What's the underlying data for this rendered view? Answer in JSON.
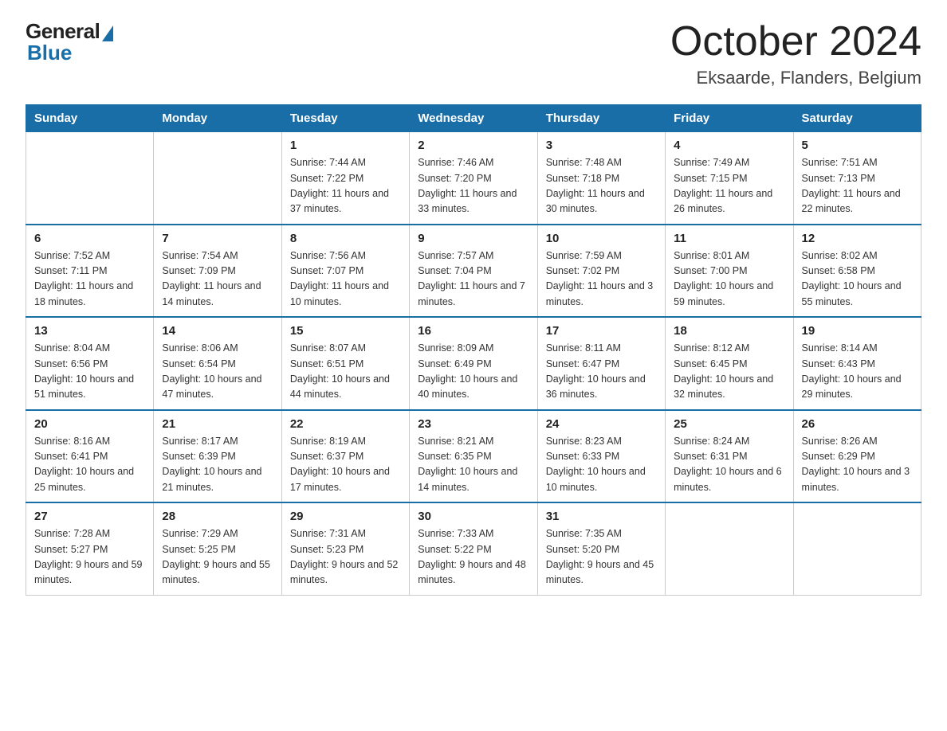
{
  "header": {
    "logo_general": "General",
    "logo_blue": "Blue",
    "month_title": "October 2024",
    "location": "Eksaarde, Flanders, Belgium"
  },
  "weekdays": [
    "Sunday",
    "Monday",
    "Tuesday",
    "Wednesday",
    "Thursday",
    "Friday",
    "Saturday"
  ],
  "weeks": [
    [
      {
        "day": "",
        "info": ""
      },
      {
        "day": "",
        "info": ""
      },
      {
        "day": "1",
        "info": "Sunrise: 7:44 AM\nSunset: 7:22 PM\nDaylight: 11 hours\nand 37 minutes."
      },
      {
        "day": "2",
        "info": "Sunrise: 7:46 AM\nSunset: 7:20 PM\nDaylight: 11 hours\nand 33 minutes."
      },
      {
        "day": "3",
        "info": "Sunrise: 7:48 AM\nSunset: 7:18 PM\nDaylight: 11 hours\nand 30 minutes."
      },
      {
        "day": "4",
        "info": "Sunrise: 7:49 AM\nSunset: 7:15 PM\nDaylight: 11 hours\nand 26 minutes."
      },
      {
        "day": "5",
        "info": "Sunrise: 7:51 AM\nSunset: 7:13 PM\nDaylight: 11 hours\nand 22 minutes."
      }
    ],
    [
      {
        "day": "6",
        "info": "Sunrise: 7:52 AM\nSunset: 7:11 PM\nDaylight: 11 hours\nand 18 minutes."
      },
      {
        "day": "7",
        "info": "Sunrise: 7:54 AM\nSunset: 7:09 PM\nDaylight: 11 hours\nand 14 minutes."
      },
      {
        "day": "8",
        "info": "Sunrise: 7:56 AM\nSunset: 7:07 PM\nDaylight: 11 hours\nand 10 minutes."
      },
      {
        "day": "9",
        "info": "Sunrise: 7:57 AM\nSunset: 7:04 PM\nDaylight: 11 hours\nand 7 minutes."
      },
      {
        "day": "10",
        "info": "Sunrise: 7:59 AM\nSunset: 7:02 PM\nDaylight: 11 hours\nand 3 minutes."
      },
      {
        "day": "11",
        "info": "Sunrise: 8:01 AM\nSunset: 7:00 PM\nDaylight: 10 hours\nand 59 minutes."
      },
      {
        "day": "12",
        "info": "Sunrise: 8:02 AM\nSunset: 6:58 PM\nDaylight: 10 hours\nand 55 minutes."
      }
    ],
    [
      {
        "day": "13",
        "info": "Sunrise: 8:04 AM\nSunset: 6:56 PM\nDaylight: 10 hours\nand 51 minutes."
      },
      {
        "day": "14",
        "info": "Sunrise: 8:06 AM\nSunset: 6:54 PM\nDaylight: 10 hours\nand 47 minutes."
      },
      {
        "day": "15",
        "info": "Sunrise: 8:07 AM\nSunset: 6:51 PM\nDaylight: 10 hours\nand 44 minutes."
      },
      {
        "day": "16",
        "info": "Sunrise: 8:09 AM\nSunset: 6:49 PM\nDaylight: 10 hours\nand 40 minutes."
      },
      {
        "day": "17",
        "info": "Sunrise: 8:11 AM\nSunset: 6:47 PM\nDaylight: 10 hours\nand 36 minutes."
      },
      {
        "day": "18",
        "info": "Sunrise: 8:12 AM\nSunset: 6:45 PM\nDaylight: 10 hours\nand 32 minutes."
      },
      {
        "day": "19",
        "info": "Sunrise: 8:14 AM\nSunset: 6:43 PM\nDaylight: 10 hours\nand 29 minutes."
      }
    ],
    [
      {
        "day": "20",
        "info": "Sunrise: 8:16 AM\nSunset: 6:41 PM\nDaylight: 10 hours\nand 25 minutes."
      },
      {
        "day": "21",
        "info": "Sunrise: 8:17 AM\nSunset: 6:39 PM\nDaylight: 10 hours\nand 21 minutes."
      },
      {
        "day": "22",
        "info": "Sunrise: 8:19 AM\nSunset: 6:37 PM\nDaylight: 10 hours\nand 17 minutes."
      },
      {
        "day": "23",
        "info": "Sunrise: 8:21 AM\nSunset: 6:35 PM\nDaylight: 10 hours\nand 14 minutes."
      },
      {
        "day": "24",
        "info": "Sunrise: 8:23 AM\nSunset: 6:33 PM\nDaylight: 10 hours\nand 10 minutes."
      },
      {
        "day": "25",
        "info": "Sunrise: 8:24 AM\nSunset: 6:31 PM\nDaylight: 10 hours\nand 6 minutes."
      },
      {
        "day": "26",
        "info": "Sunrise: 8:26 AM\nSunset: 6:29 PM\nDaylight: 10 hours\nand 3 minutes."
      }
    ],
    [
      {
        "day": "27",
        "info": "Sunrise: 7:28 AM\nSunset: 5:27 PM\nDaylight: 9 hours\nand 59 minutes."
      },
      {
        "day": "28",
        "info": "Sunrise: 7:29 AM\nSunset: 5:25 PM\nDaylight: 9 hours\nand 55 minutes."
      },
      {
        "day": "29",
        "info": "Sunrise: 7:31 AM\nSunset: 5:23 PM\nDaylight: 9 hours\nand 52 minutes."
      },
      {
        "day": "30",
        "info": "Sunrise: 7:33 AM\nSunset: 5:22 PM\nDaylight: 9 hours\nand 48 minutes."
      },
      {
        "day": "31",
        "info": "Sunrise: 7:35 AM\nSunset: 5:20 PM\nDaylight: 9 hours\nand 45 minutes."
      },
      {
        "day": "",
        "info": ""
      },
      {
        "day": "",
        "info": ""
      }
    ]
  ]
}
